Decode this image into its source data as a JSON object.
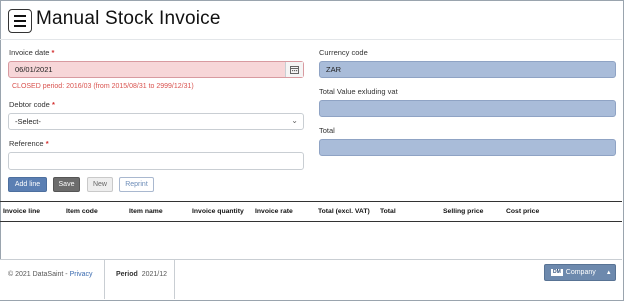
{
  "header": {
    "title": "Manual Stock Invoice"
  },
  "form": {
    "invoice_date": {
      "label": "Invoice date",
      "required": "*",
      "value": "06/01/2021",
      "error": "CLOSED period: 2016/03 (from 2015/08/31 to 2999/12/31)"
    },
    "debtor_code": {
      "label": "Debtor code",
      "required": "*",
      "value": "-Select-"
    },
    "reference": {
      "label": "Reference",
      "required": "*",
      "value": ""
    },
    "currency_code": {
      "label": "Currency code",
      "value": "ZAR"
    },
    "total_value_ex_vat": {
      "label": "Total Value exluding vat",
      "value": ""
    },
    "total": {
      "label": "Total",
      "value": ""
    }
  },
  "buttons": {
    "add_line": "Add line",
    "save": "Save",
    "new": "New",
    "reprint": "Reprint"
  },
  "table": {
    "columns": [
      "Invoice line",
      "Item code",
      "Item name",
      "Invoice quantity",
      "Invoice rate",
      "Total (excl. VAT)",
      "Total",
      "Selling price",
      "Cost price"
    ],
    "rows": []
  },
  "footer": {
    "copyright": "© 2021 DataSaint - ",
    "privacy": "Privacy",
    "period_label": "Period",
    "period_value": "2021/12",
    "company_logo": "DM",
    "company_label": "Company"
  },
  "colors": {
    "primary": "#5b7fb3",
    "error": "#d9534f",
    "readonly_field": "#a9bcd9",
    "invalid_field": "#f7d6d8"
  }
}
